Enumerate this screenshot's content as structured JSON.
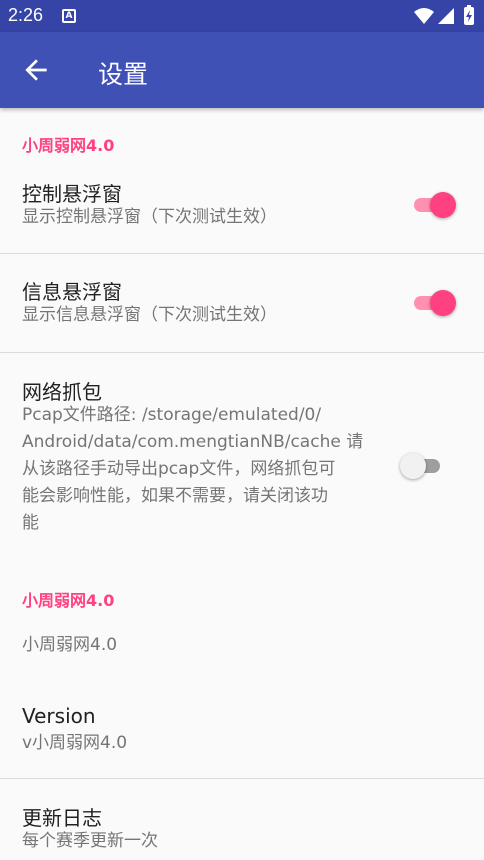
{
  "status_bar": {
    "time": "2:26",
    "notification_icon": "A"
  },
  "app_bar": {
    "title": "设置",
    "back_icon": "arrow-left-icon"
  },
  "category_1": {
    "label": "小周弱网4.0"
  },
  "control_float": {
    "title": "控制悬浮窗",
    "summary": "显示控制悬浮窗（下次测试生效）",
    "enabled": true
  },
  "info_float": {
    "title": "信息悬浮窗",
    "summary": "显示信息悬浮窗（下次测试生效）",
    "enabled": true
  },
  "packet_capture": {
    "title": "网络抓包",
    "summary_lines": [
      "Pcap文件路径: /storage/emulated/0/",
      "Android/data/com.mengtianNB/cache 请",
      "从该路径手动导出pcap文件，网络抓包可",
      "能会影响性能，如果不需要，请关闭该功",
      "能"
    ],
    "enabled": false
  },
  "category_2": {
    "label": "小周弱网4.0"
  },
  "plain_item": {
    "summary": "小周弱网4.0"
  },
  "version": {
    "title": "Version",
    "summary": "v小周弱网4.0"
  },
  "changelog": {
    "title": "更新日志",
    "summary": "每个赛季更新一次"
  },
  "colors": {
    "primary": "#3f51b5",
    "primary_dark": "#3544a6",
    "accent": "#ff4081"
  }
}
